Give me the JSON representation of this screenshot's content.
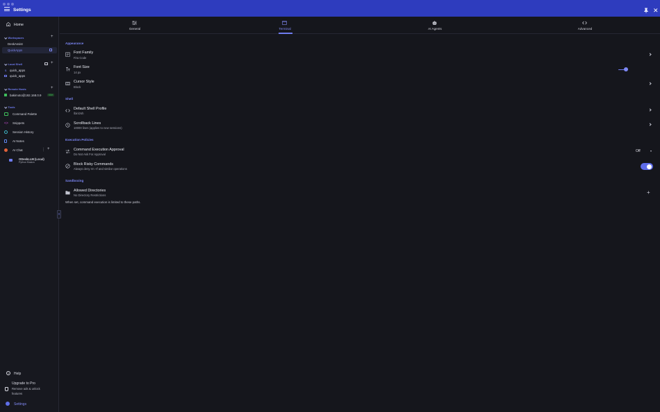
{
  "window": {
    "title": "Settings"
  },
  "sidebar": {
    "home": "Home",
    "workspaces": {
      "label": "Workspaces",
      "items": [
        "DeskAssist",
        "QuickApps"
      ]
    },
    "local_shell": {
      "label": "Local Shell",
      "items": [
        "quick_apps",
        "quick_apps"
      ]
    },
    "remote_hosts": {
      "label": "Remote Hosts",
      "items": [
        {
          "label": "bakimoto@192.168.0.9",
          "badge": "SSH"
        }
      ]
    },
    "tools": {
      "label": "Tools",
      "items": [
        "Command Palette",
        "Snippets",
        "Session History",
        "AI Notes",
        "AI Chat"
      ]
    },
    "chat_session": {
      "title": "ODeskLLM (Local)",
      "subtitle": "Python Basics"
    },
    "help": "Help",
    "upgrade": {
      "title": "Upgrade to Pro",
      "desc": "Remove ads & unlock features"
    },
    "settings": "Settings"
  },
  "tabs": [
    {
      "label": "General",
      "icon": "sliders-icon"
    },
    {
      "label": "Terminal",
      "icon": "terminal-icon"
    },
    {
      "label": "AI Agents",
      "icon": "robot-icon"
    },
    {
      "label": "Advanced",
      "icon": "code-icon"
    }
  ],
  "content": {
    "appearance": {
      "title": "Appearance",
      "font_family": {
        "label": "Font Family",
        "value": "Fira Code"
      },
      "font_size": {
        "label": "Font Size",
        "value": "14 px",
        "slider_level": 0.6
      },
      "cursor_style": {
        "label": "Cursor Style",
        "value": "Block"
      }
    },
    "shell": {
      "title": "Shell",
      "default_profile": {
        "label": "Default Shell Profile",
        "value": "/bin/zsh"
      },
      "scrollback": {
        "label": "Scrollback Lines",
        "value": "10000 lines (applies to new sessions)"
      }
    },
    "execution": {
      "title": "Execution Policies",
      "approval": {
        "label": "Command Execution Approval",
        "value": "Do Not Ask For Approval",
        "selected": "Off"
      },
      "block_risky": {
        "label": "Block Risky Commands",
        "value": "Always deny rm -rf and similar operations",
        "enabled": true
      }
    },
    "sandboxing": {
      "title": "Sandboxing",
      "allowed_dirs": {
        "label": "Allowed Directories",
        "value": "No Directory Restrictions"
      },
      "note": "When set, command execution is limited to these paths."
    }
  },
  "colors": {
    "accent": "#6f7cf0",
    "titlebar": "#2e3cbe",
    "background": "#15161c"
  }
}
